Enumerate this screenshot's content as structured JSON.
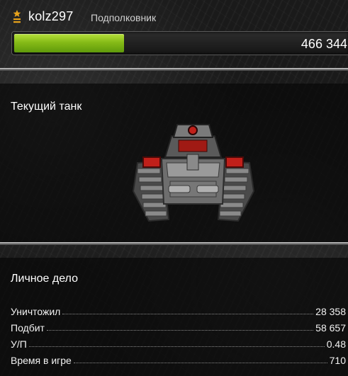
{
  "player": {
    "username": "kolz297",
    "rank": "Подполковник",
    "rank_icon": "rank-insignia-icon"
  },
  "experience": {
    "value_label": "466 344",
    "progress_fraction": 0.33
  },
  "colors": {
    "progress_fill": "#86bb17",
    "rank_icon": "#e6a21c",
    "accent_red": "#c0201a"
  },
  "current_tank": {
    "title": "Текущий танк",
    "image_icon": "tank-image"
  },
  "personal_file": {
    "title": "Личное дело",
    "stats": [
      {
        "label": "Уничтожил",
        "value": "28 358"
      },
      {
        "label": "Подбит",
        "value": "58 657"
      },
      {
        "label": "У/П",
        "value": "0.48"
      },
      {
        "label": "Время в игре",
        "value": "710"
      }
    ]
  }
}
